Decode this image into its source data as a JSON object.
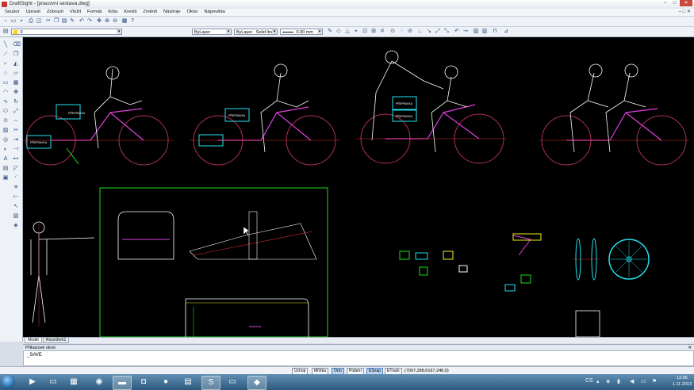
{
  "window": {
    "title": "DraftSight - [pracovni sestava.dwg]",
    "minimize": "–",
    "maximize": "□",
    "close": "✕"
  },
  "menu": [
    "Soubor",
    "Upravit",
    "Zobrazit",
    "Vložit",
    "Formát",
    "Kóta",
    "Kreslit",
    "Změnit",
    "Nástroje",
    "Okno",
    "Nápověda"
  ],
  "menu_controls": "– □ ✕",
  "toolbar": {
    "layer_value": "0",
    "linecolor_value": "ByLayer",
    "linestyle_value": "ByLayer",
    "lineweight_label": "Solid line",
    "lineweight_value": "0.00 mm",
    "lineweight_extra": ""
  },
  "tabs": [
    "Model",
    "Rozvržení1"
  ],
  "command": {
    "header": "Příkazové okno",
    "header_close": "✕",
    "text": "_SAVE"
  },
  "status": {
    "buttons": [
      {
        "label": "Úchop",
        "on": false
      },
      {
        "label": "Mřížka",
        "on": false
      },
      {
        "label": "Orto",
        "on": true
      },
      {
        "label": "Polární",
        "on": false
      },
      {
        "label": "ESnap",
        "on": true
      },
      {
        "label": "ETrack",
        "on": false
      }
    ],
    "coordinates": "(7007,288,6167,248,0)"
  },
  "canvas_labels": {
    "a": "PŘEPRAVKA",
    "b": "PŘEPRAVKA",
    "c": "PŘEPRAVKA",
    "d": "PŘEPRAVKA",
    "e": "PŘEPRAVKA"
  },
  "taskbar": {
    "lang": "CS",
    "time": "12:06",
    "date": "1.11.2013"
  },
  "colors": {
    "canvas": "#000000",
    "wheel": "#b0305a",
    "frame": "#e040e0",
    "figure": "#ffffff",
    "green": "#18e018",
    "cyan": "#22e0f0",
    "yellow": "#f0f020"
  }
}
